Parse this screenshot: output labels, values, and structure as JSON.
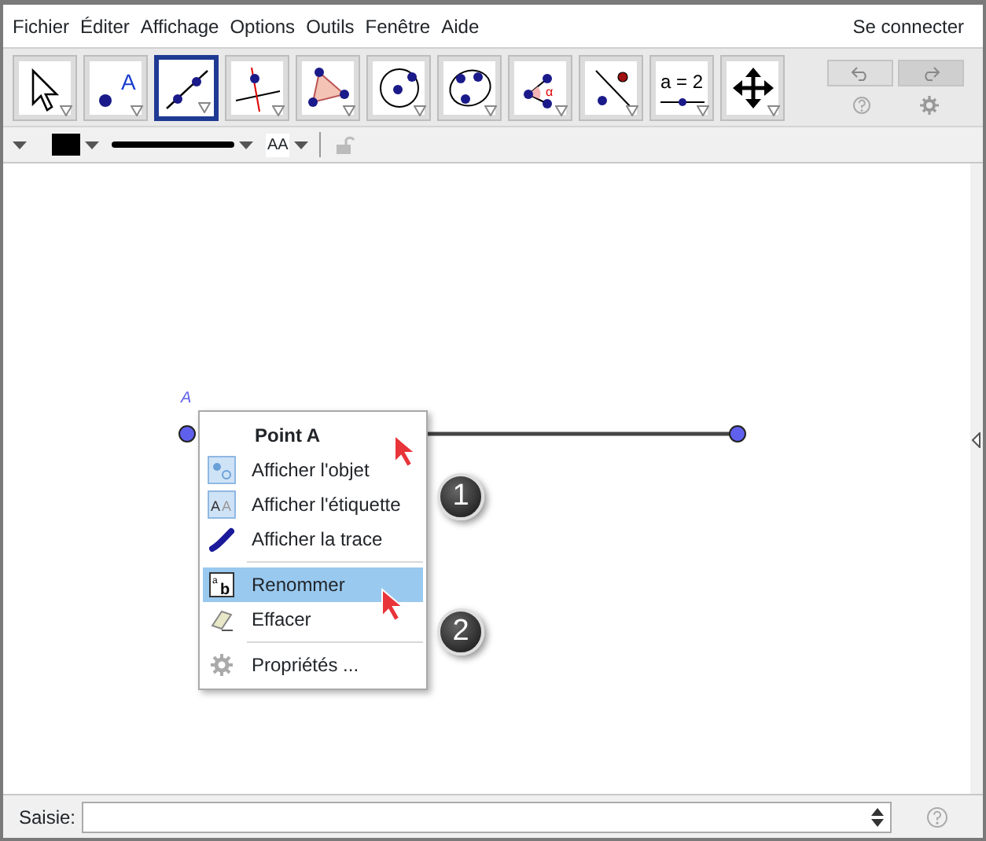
{
  "menu_bar": {
    "items": [
      "Fichier",
      "Éditer",
      "Affichage",
      "Options",
      "Outils",
      "Fenêtre",
      "Aide"
    ],
    "sign_in": "Se connecter"
  },
  "tools": [
    {
      "kind": "move",
      "selected": false
    },
    {
      "kind": "point",
      "selected": false,
      "text": "A"
    },
    {
      "kind": "line",
      "selected": true
    },
    {
      "kind": "perpendicular",
      "selected": false
    },
    {
      "kind": "polygon",
      "selected": false
    },
    {
      "kind": "circle",
      "selected": false
    },
    {
      "kind": "conic",
      "selected": false
    },
    {
      "kind": "angle",
      "selected": false,
      "text": "α"
    },
    {
      "kind": "reflect",
      "selected": false
    },
    {
      "kind": "slider",
      "selected": false,
      "text": "a = 2"
    },
    {
      "kind": "pan",
      "selected": false
    }
  ],
  "style_bar": {
    "text_size": "AA"
  },
  "canvas": {
    "point_label": "A"
  },
  "context_menu": {
    "title": "Point A",
    "toggles": [
      {
        "kind": "object",
        "label": "Afficher l'objet",
        "checked": true
      },
      {
        "kind": "label",
        "label": "Afficher l'étiquette",
        "checked": true,
        "icon_text": [
          "A",
          "A"
        ]
      },
      {
        "kind": "trace",
        "label": "Afficher la trace",
        "checked": false
      }
    ],
    "actions": [
      {
        "kind": "rename",
        "label": "Renommer",
        "selected": true,
        "icon_text": [
          "a",
          "b"
        ]
      },
      {
        "kind": "delete",
        "label": "Effacer",
        "selected": false
      },
      {
        "kind": "properties",
        "label": "Propriétés ...",
        "selected": false
      }
    ]
  },
  "callouts": [
    "1",
    "2"
  ],
  "input_bar": {
    "label": "Saisie:"
  }
}
